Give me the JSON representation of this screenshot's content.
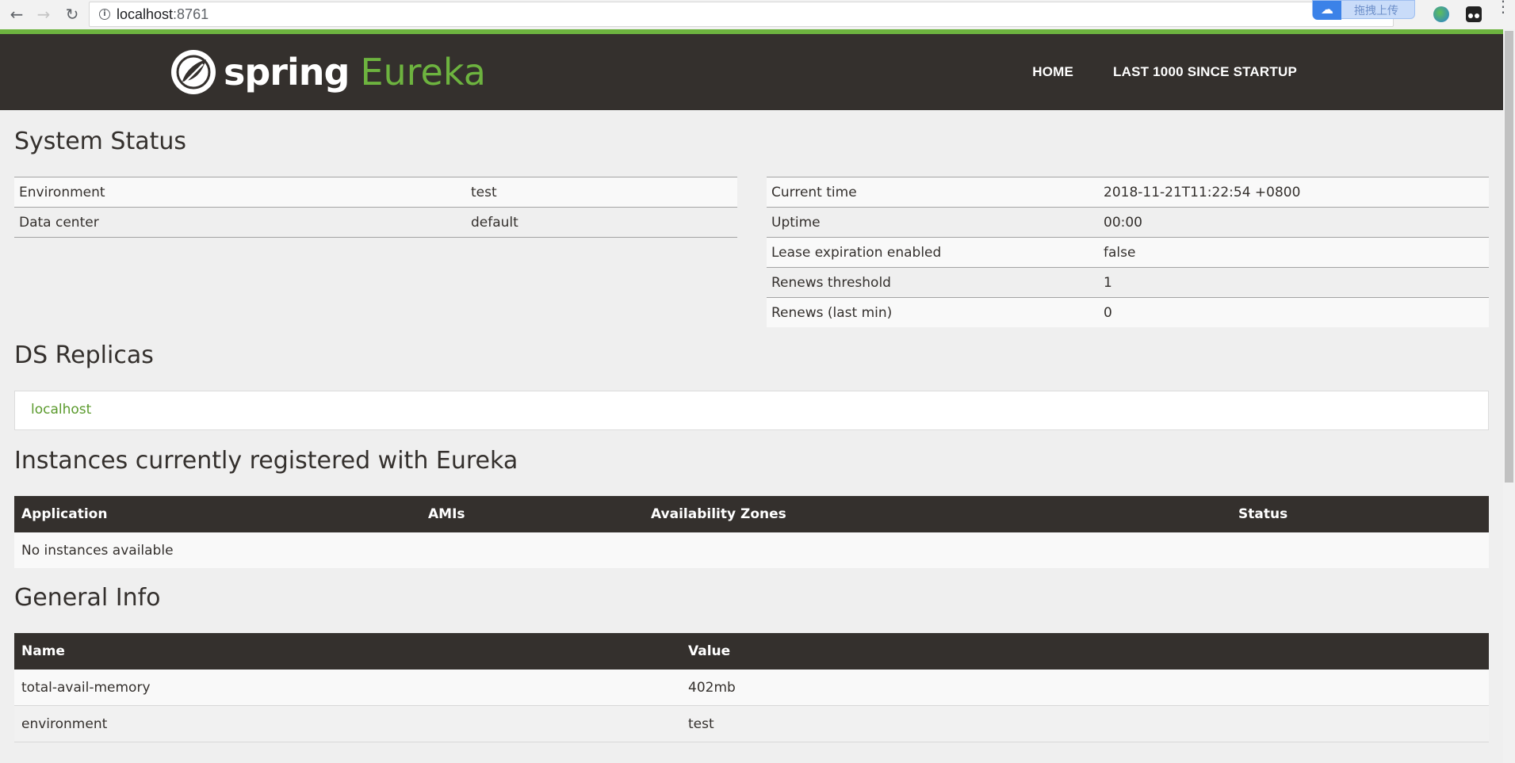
{
  "browser": {
    "url_host": "localhost",
    "url_port": ":8761",
    "upload_extension_label": "拖拽上传"
  },
  "header": {
    "logo_spring": "spring",
    "logo_eureka": "Eureka",
    "nav": [
      "HOME",
      "LAST 1000 SINCE STARTUP"
    ]
  },
  "system_status": {
    "title": "System Status",
    "left": [
      {
        "label": "Environment",
        "value": "test"
      },
      {
        "label": "Data center",
        "value": "default"
      }
    ],
    "right": [
      {
        "label": "Current time",
        "value": "2018-11-21T11:22:54 +0800"
      },
      {
        "label": "Uptime",
        "value": "00:00"
      },
      {
        "label": "Lease expiration enabled",
        "value": "false"
      },
      {
        "label": "Renews threshold",
        "value": "1"
      },
      {
        "label": "Renews (last min)",
        "value": "0"
      }
    ]
  },
  "ds_replicas": {
    "title": "DS Replicas",
    "link": "localhost"
  },
  "instances": {
    "title": "Instances currently registered with Eureka",
    "columns": [
      "Application",
      "AMIs",
      "Availability Zones",
      "Status"
    ],
    "empty_text": "No instances available"
  },
  "general_info": {
    "title": "General Info",
    "columns": [
      "Name",
      "Value"
    ],
    "rows": [
      {
        "name": "total-avail-memory",
        "value": "402mb"
      },
      {
        "name": "environment",
        "value": "test"
      }
    ]
  },
  "colors": {
    "brand_green": "#6db33f",
    "header_dark": "#34302d",
    "page_bg": "#efefef"
  }
}
